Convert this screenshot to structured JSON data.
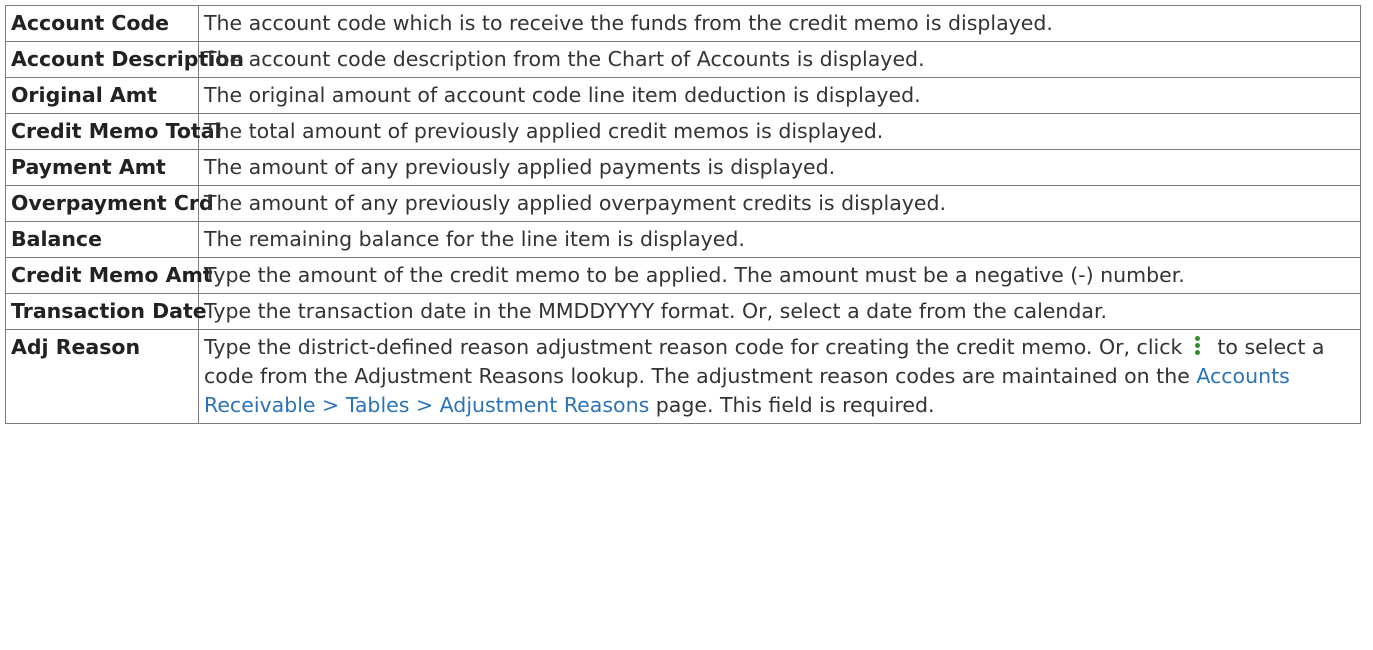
{
  "rows": [
    {
      "field": "Account Code",
      "description": "The account code which is to receive the funds from the credit memo is displayed."
    },
    {
      "field": "Account Description",
      "description": "The account code description from the Chart of Accounts is displayed."
    },
    {
      "field": "Original Amt",
      "description": "The original amount of account code line item deduction is displayed."
    },
    {
      "field": "Credit Memo Total",
      "description": "The total amount of previously applied credit memos is displayed."
    },
    {
      "field": "Payment Amt",
      "description": "The amount of any previously applied payments is displayed."
    },
    {
      "field": "Overpayment Crd",
      "description": "The amount of any previously applied overpayment credits is displayed."
    },
    {
      "field": "Balance",
      "description": "The remaining balance for the line item is displayed."
    },
    {
      "field": "Credit Memo Amt",
      "description": "Type the amount of the credit memo to be applied. The amount must be a negative (-) number."
    },
    {
      "field": "Transaction Date",
      "description": "Type the transaction date in the MMDDYYYY format. Or, select a date from the calendar."
    }
  ],
  "adj_reason": {
    "field": "Adj Reason",
    "text_before_icon": "Type the district-defined reason adjustment reason code for creating the credit memo. Or, click",
    "icon": "kebab-menu-icon",
    "icon_color": "#2f8f2f",
    "text_after_icon": "to select a code from the Adjustment Reasons lookup. The adjustment reason codes are maintained on the",
    "link_text": "Accounts Receivable > Tables > Adjustment Reasons",
    "text_after_link": "page. This field is required."
  },
  "colors": {
    "border": "#7c7c7c",
    "link": "#2b73b7",
    "text": "#333333"
  }
}
